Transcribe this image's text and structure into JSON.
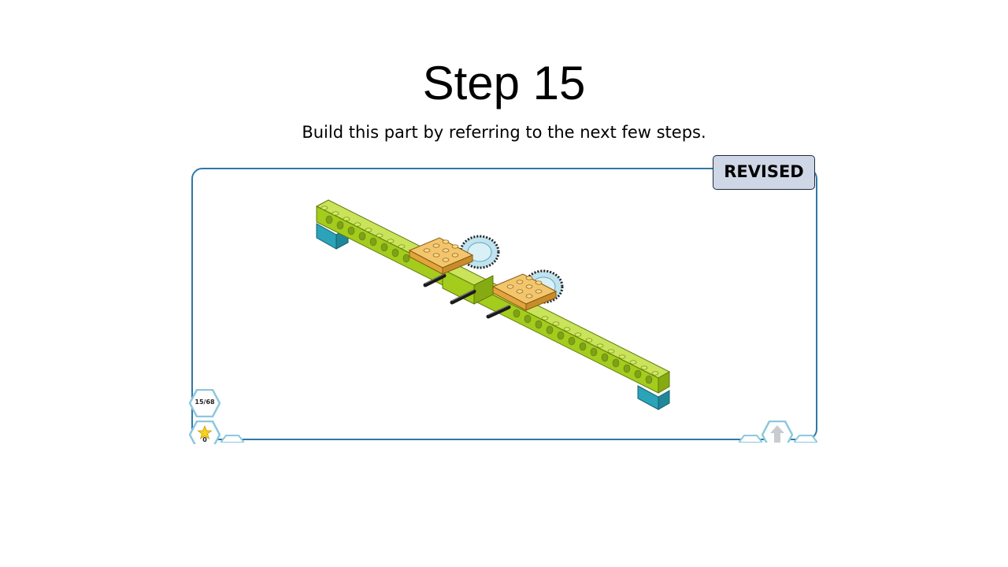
{
  "slide": {
    "title": "Step 15",
    "subtitle": "Build this part by referring to the next few steps.",
    "badge": "REVISED"
  },
  "viewer": {
    "step_counter": "15/68",
    "star_count": "0"
  },
  "colors": {
    "frame_border": "#2f78a8",
    "badge_fill": "#cfd6e6",
    "beam_lime": "#a4cc1c",
    "brick_teal": "#2ba3b8",
    "plate_orange": "#f3b04a",
    "gear_lightblue": "#bfe3ef"
  },
  "icons": [
    "step-counter-icon",
    "star-icon",
    "up-arrow-icon"
  ]
}
